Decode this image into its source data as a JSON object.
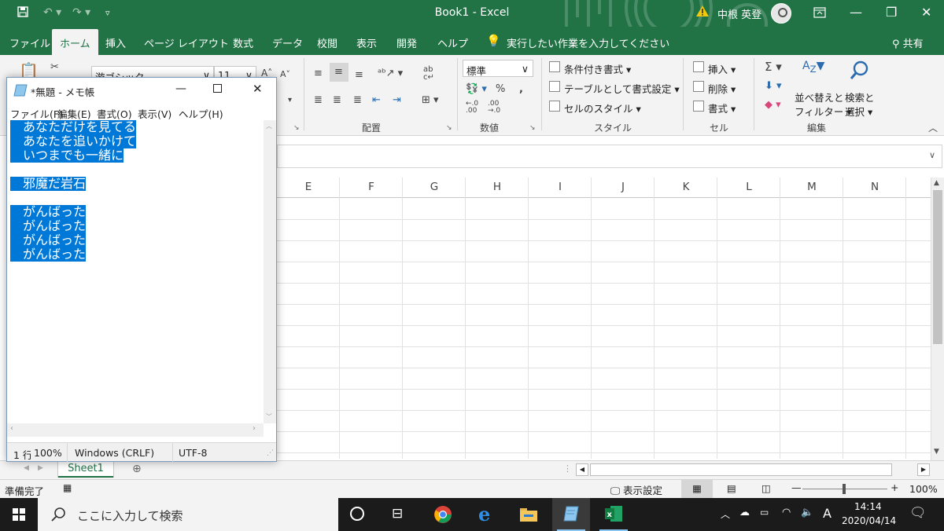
{
  "excel": {
    "title": "Book1  -  Excel",
    "user_name": "中根 英登",
    "tabs": [
      "ファイル",
      "ホーム",
      "挿入",
      "ページ レイアウト",
      "数式",
      "データ",
      "校閲",
      "表示",
      "開発",
      "ヘルプ"
    ],
    "tell_me": "実行したい作業を入力してください",
    "share": "共有",
    "font_name": "游ゴシック",
    "font_size": "11",
    "number_format": "標準",
    "groups": {
      "alignment": "配置",
      "number": "数値",
      "styles": "スタイル",
      "cells": "セル",
      "editing": "編集"
    },
    "styles_cmds": {
      "conditional": "条件付き書式",
      "table": "テーブルとして書式設定",
      "cell_styles": "セルのスタイル"
    },
    "cells_cmds": {
      "insert": "挿入",
      "delete": "削除",
      "format": "書式"
    },
    "editing_cmds": {
      "sort_l1": "並べ替えと",
      "sort_l2": "フィルター",
      "find_l1": "検索と",
      "find_l2": "選択"
    },
    "columns": [
      "E",
      "F",
      "G",
      "H",
      "I",
      "J",
      "K",
      "L",
      "M",
      "N"
    ],
    "sheet_tab": "Sheet1",
    "status_ready": "準備完了",
    "display_settings": "表示設定",
    "zoom": "100%"
  },
  "notepad": {
    "title": "*無題 - メモ帳",
    "menu": [
      "ファイル(F)",
      "編集(E)",
      "書式(O)",
      "表示(V)",
      "ヘルプ(H)"
    ],
    "lines": [
      "あなただけを見てる",
      "あなたを追いかけて",
      "いつまでも一緒に",
      "",
      "邪魔だ岩石",
      "",
      "がんばった",
      "がんばった",
      "がんばった",
      "がんばった"
    ],
    "status": {
      "position": "1 行",
      "zoom": "100%",
      "eol": "Windows (CRLF)",
      "encoding": "UTF-8"
    }
  },
  "taskbar": {
    "search_placeholder": "ここに入力して検索",
    "time": "14:14",
    "date": "2020/04/14",
    "ime": "A"
  }
}
